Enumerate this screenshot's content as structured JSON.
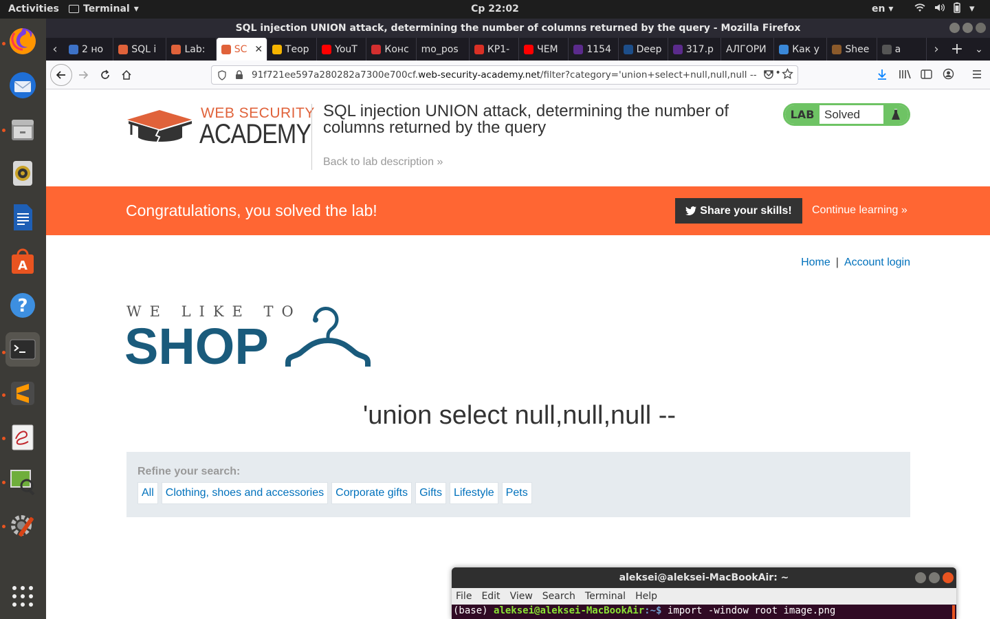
{
  "system_bar": {
    "activities": "Activities",
    "app_menu": "Terminal",
    "clock": "Ср 22:02",
    "language": "en"
  },
  "dock": {
    "apps": [
      "firefox-icon",
      "thunderbird-icon",
      "files-icon",
      "rhythmbox-icon",
      "writer-icon",
      "software-center-icon",
      "help-icon",
      "terminal-icon",
      "sublime-text-icon",
      "evince-icon",
      "image-viewer-icon",
      "settings-icon",
      "show-apps-icon"
    ]
  },
  "browser": {
    "window_title": "SQL injection UNION attack, determining the number of columns returned by the query - Mozilla Firefox",
    "tabs": [
      {
        "label": "2 но",
        "color": "#3d72c7",
        "icon": "badge-2-icon"
      },
      {
        "label": "SQL i",
        "color": "#e0623a",
        "icon": "portswigger-icon"
      },
      {
        "label": "Lab:",
        "color": "#e0623a",
        "icon": "portswigger-icon"
      },
      {
        "label": "SC",
        "color": "#e0623a",
        "icon": "portswigger-icon",
        "current": true
      },
      {
        "label": "Теор",
        "color": "#f5b400",
        "icon": "fs-icon"
      },
      {
        "label": "YouT",
        "color": "#ff0000",
        "icon": "youtube-icon"
      },
      {
        "label": "Конс",
        "color": "#d32f2f",
        "icon": "pdf-icon"
      },
      {
        "label": "mo_pos",
        "color": "",
        "icon": ""
      },
      {
        "label": "КР1-",
        "color": "#d93025",
        "icon": "gmail-icon"
      },
      {
        "label": "ЧЕМ",
        "color": "#ff0000",
        "icon": "youtube-icon"
      },
      {
        "label": "1154",
        "color": "#5b2b8c",
        "icon": "circle-icon"
      },
      {
        "label": "Deep",
        "color": "#1d4e89",
        "icon": "deepl-icon"
      },
      {
        "label": "317.p",
        "color": "#5b2b8c",
        "icon": "circle-icon"
      },
      {
        "label": "АЛГОРИ",
        "color": "",
        "icon": ""
      },
      {
        "label": "Как у",
        "color": "#3a88d8",
        "icon": "snowflake-icon"
      },
      {
        "label": "Shee",
        "color": "#8b5a2b",
        "icon": "sheep-icon"
      },
      {
        "label": "a",
        "color": "#555555",
        "icon": "mic-icon"
      }
    ],
    "url_prefix": "91f721ee597a280282a7300e700cf.",
    "url_domain": "web-security-academy.net",
    "url_path": "/filter?category='union+select+null,null,null --"
  },
  "lab_header": {
    "logo_line1": "WEB SECURITY",
    "logo_line2": "ACADEMY",
    "title": "SQL injection UNION attack, determining the number of columns returned by the query",
    "back_link": "Back to lab description",
    "badge_lab": "LAB",
    "badge_status": "Solved"
  },
  "banner": {
    "message": "Congratulations, you solved the lab!",
    "share_button": "Share your skills!",
    "continue_link": "Continue learning"
  },
  "site_nav": {
    "home": "Home",
    "separator": "|",
    "account": "Account login"
  },
  "shop_logo": {
    "tagline": "WE LIKE TO",
    "word": "SHOP"
  },
  "search_heading": "'union select null,null,null --",
  "refine": {
    "label": "Refine your search:",
    "categories": [
      "All",
      "Clothing, shoes and accessories",
      "Corporate gifts",
      "Gifts",
      "Lifestyle",
      "Pets"
    ]
  },
  "terminal": {
    "title": "aleksei@aleksei-MacBookAir: ~",
    "menu": [
      "File",
      "Edit",
      "View",
      "Search",
      "Terminal",
      "Help"
    ],
    "prompt_env": "(base)",
    "prompt_user": "aleksei@aleksei-MacBookAir",
    "prompt_path": ":~$",
    "command": " import -window root image.png"
  },
  "colors": {
    "accent_orange": "#ff6633",
    "solved_green": "#6ec364",
    "link_blue": "#0071bc",
    "shop_blue": "#1a5b7c"
  }
}
